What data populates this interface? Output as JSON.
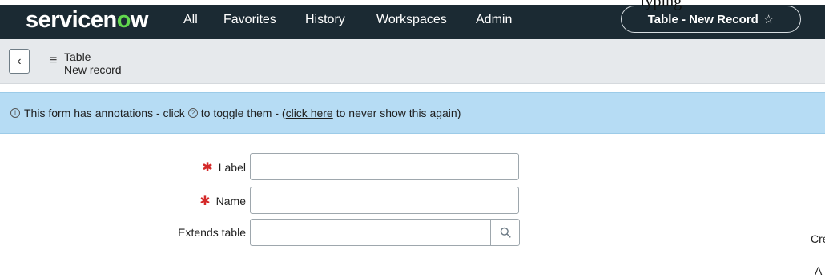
{
  "topbar": {
    "logo_prefix": "servicen",
    "logo_accent": "o",
    "logo_suffix": "w",
    "nav": [
      "All",
      "Favorites",
      "History",
      "Workspaces",
      "Admin"
    ],
    "record_pill": "Table - New Record",
    "star_icon": "star-outline-icon",
    "overflow_text": "typing"
  },
  "header": {
    "back_icon": "chevron-left-icon",
    "menu_icon": "hamburger-menu-icon",
    "title": "Table",
    "subtitle": "New record"
  },
  "banner": {
    "info_icon": "info-icon",
    "text_before": "This form has annotations - click",
    "help_icon": "help-circle-icon",
    "text_middle": "to toggle them - (",
    "link_text": "click here",
    "text_after": "to never show this again)"
  },
  "form": {
    "fields": [
      {
        "label": "Label",
        "required": true,
        "value": "",
        "placeholder": ""
      },
      {
        "label": "Name",
        "required": true,
        "value": "",
        "placeholder": ""
      },
      {
        "label": "Extends table",
        "required": false,
        "value": "",
        "placeholder": ""
      }
    ],
    "lookup_icon": "search-icon"
  },
  "side": {
    "text_1": "Cre",
    "text_2": "A"
  },
  "colors": {
    "topbar_bg": "#1b2a33",
    "logo_accent": "#62d84e",
    "header_bg": "#e6e9ec",
    "banner_bg": "#b6dcf4",
    "required": "#d42929"
  }
}
